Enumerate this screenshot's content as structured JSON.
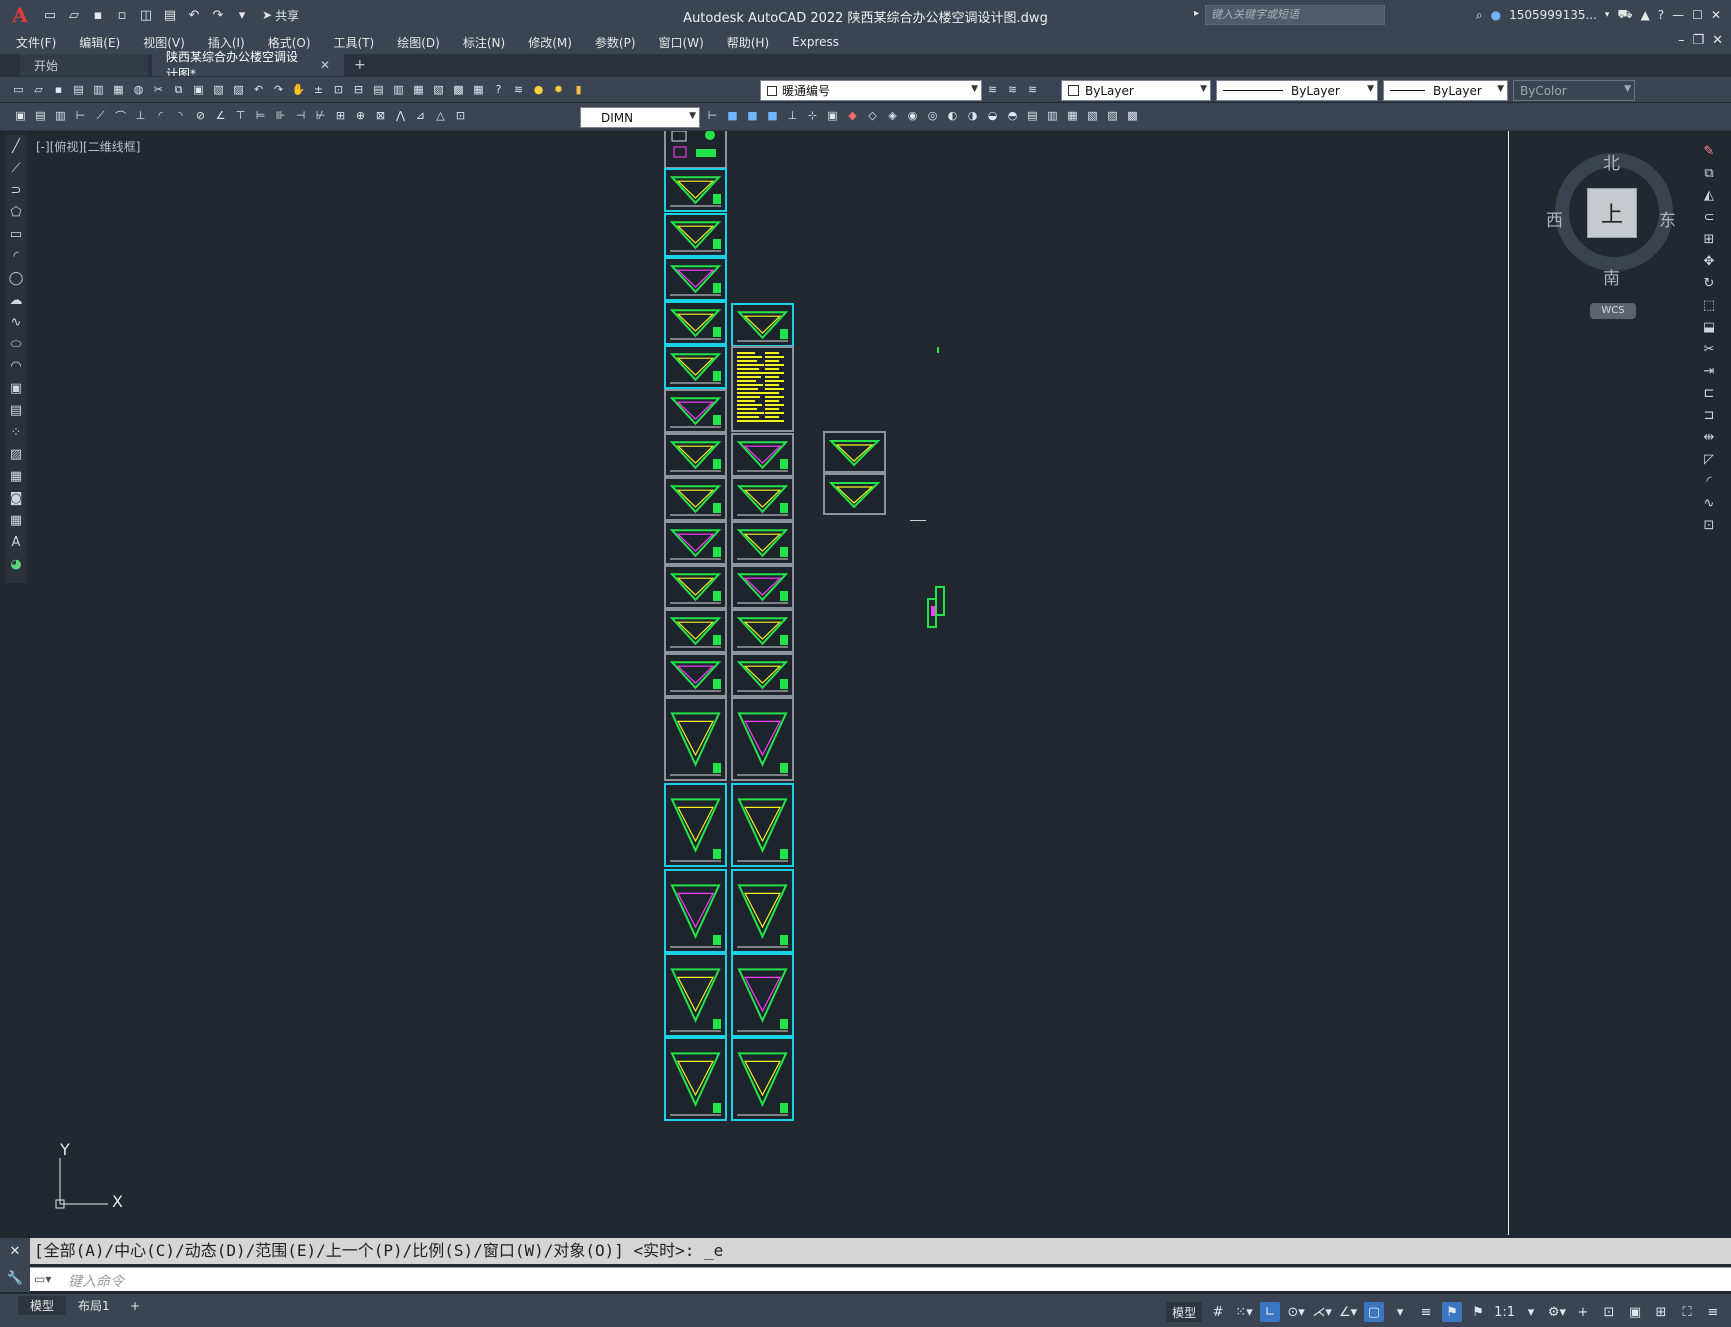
{
  "app": {
    "logo": "A",
    "window_title": "Autodesk AutoCAD 2022    陕西某综合办公楼空调设计图.dwg",
    "share_label": "共享",
    "search_placeholder": "键入关键字或短语",
    "user": "1505999135...",
    "window_buttons": {
      "minimize": "—",
      "restore": "☐",
      "close": "✕"
    }
  },
  "menu": [
    "文件(F)",
    "编辑(E)",
    "视图(V)",
    "插入(I)",
    "格式(O)",
    "工具(T)",
    "绘图(D)",
    "标注(N)",
    "修改(M)",
    "参数(P)",
    "窗口(W)",
    "帮助(H)",
    "Express"
  ],
  "tabs": {
    "start": "开始",
    "file": "陕西某综合办公楼空调设计图*",
    "add": "+"
  },
  "toolbar": {
    "layer_combo": "暖通编号",
    "color_combo": "ByLayer",
    "linetype_combo": "ByLayer",
    "lineweight_combo": "ByLayer",
    "plotstyle_combo": "ByColor",
    "dimstyle_combo": "DIMN"
  },
  "viewport": {
    "label": "[-][俯视][二维线框]"
  },
  "viewcube": {
    "north": "北",
    "south": "南",
    "east": "东",
    "west": "西",
    "top_face": "上",
    "wcs": "WCS"
  },
  "ucs": {
    "x": "X",
    "y": "Y"
  },
  "command": {
    "history": "[全部(A)/中心(C)/动态(D)/范围(E)/上一个(P)/比例(S)/窗口(W)/对象(O)] <实时>: _e",
    "placeholder": "键入命令"
  },
  "status": {
    "layout_tabs": [
      "模型",
      "布局1"
    ],
    "add": "+",
    "model_label": "模型",
    "scale": "1:1"
  },
  "colors": {
    "accent_cyan": "#19d1e6",
    "drawing_green": "#23e34a",
    "drawing_magenta": "#ff3cff",
    "drawing_yellow": "#f3f01f",
    "background": "#212830",
    "ui_panel": "#3b4453"
  }
}
